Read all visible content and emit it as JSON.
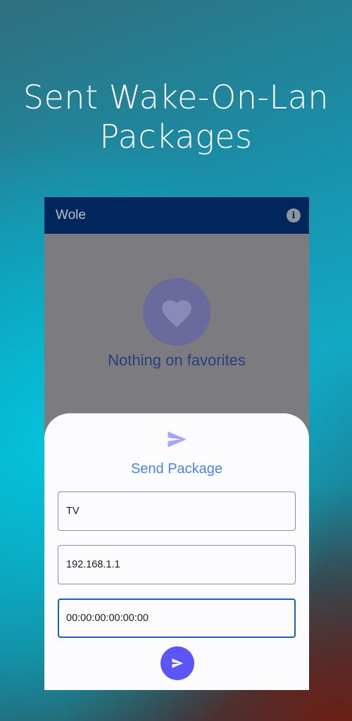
{
  "promo": {
    "title_line1": "Sent Wake-On-Lan",
    "title_line2": "Packages"
  },
  "app": {
    "appbar": {
      "title": "Wole",
      "info_icon": "info-icon",
      "info_glyph": "i"
    },
    "empty_state": {
      "icon": "heart-icon",
      "text": "Nothing on favorites"
    },
    "sheet": {
      "icon": "send-icon",
      "title": "Send Package",
      "fields": {
        "name": "TV",
        "ip": "192.168.1.1",
        "mac": "00:00:00:00:00:00"
      },
      "send_button_icon": "send-icon"
    }
  },
  "colors": {
    "appbar": "#00265c",
    "accent": "#5b56f5",
    "sheet_title": "#4a86db",
    "focused_field_border": "#1f5fb0"
  }
}
